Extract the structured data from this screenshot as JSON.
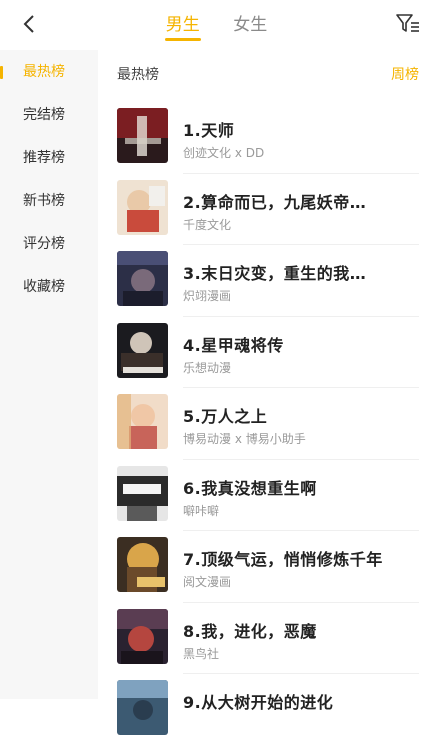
{
  "header": {
    "tabs": [
      {
        "label": "男生",
        "active": true
      },
      {
        "label": "女生",
        "active": false
      }
    ],
    "icons": {
      "back": "chevron-left-icon",
      "filter": "filter-icon"
    }
  },
  "sidebar": {
    "items": [
      {
        "label": "最热榜",
        "active": true
      },
      {
        "label": "完结榜",
        "active": false
      },
      {
        "label": "推荐榜",
        "active": false
      },
      {
        "label": "新书榜",
        "active": false
      },
      {
        "label": "评分榜",
        "active": false
      },
      {
        "label": "收藏榜",
        "active": false
      }
    ]
  },
  "main": {
    "title": "最热榜",
    "period": "周榜",
    "items": [
      {
        "title": "1.天师",
        "subtitle": "创迹文化 x DD"
      },
      {
        "title": "2.算命而已，九尾妖帝…",
        "subtitle": "千度文化"
      },
      {
        "title": "3.末日灾变，重生的我…",
        "subtitle": "炽翊漫画"
      },
      {
        "title": "4.星甲魂将传",
        "subtitle": "乐想动漫"
      },
      {
        "title": "5.万人之上",
        "subtitle": "博易动漫 x 博易小助手"
      },
      {
        "title": "6.我真没想重生啊",
        "subtitle": "噼咔噼"
      },
      {
        "title": "7.顶级气运，悄悄修炼千年",
        "subtitle": "阅文漫画"
      },
      {
        "title": "8.我，进化，恶魔",
        "subtitle": "黑鸟社"
      },
      {
        "title": "9.从大树开始的进化",
        "subtitle": ""
      }
    ]
  },
  "colors": {
    "accent": "#f5b400",
    "sidebar_bg": "#f7f7f7",
    "muted": "#9a9a9a"
  }
}
